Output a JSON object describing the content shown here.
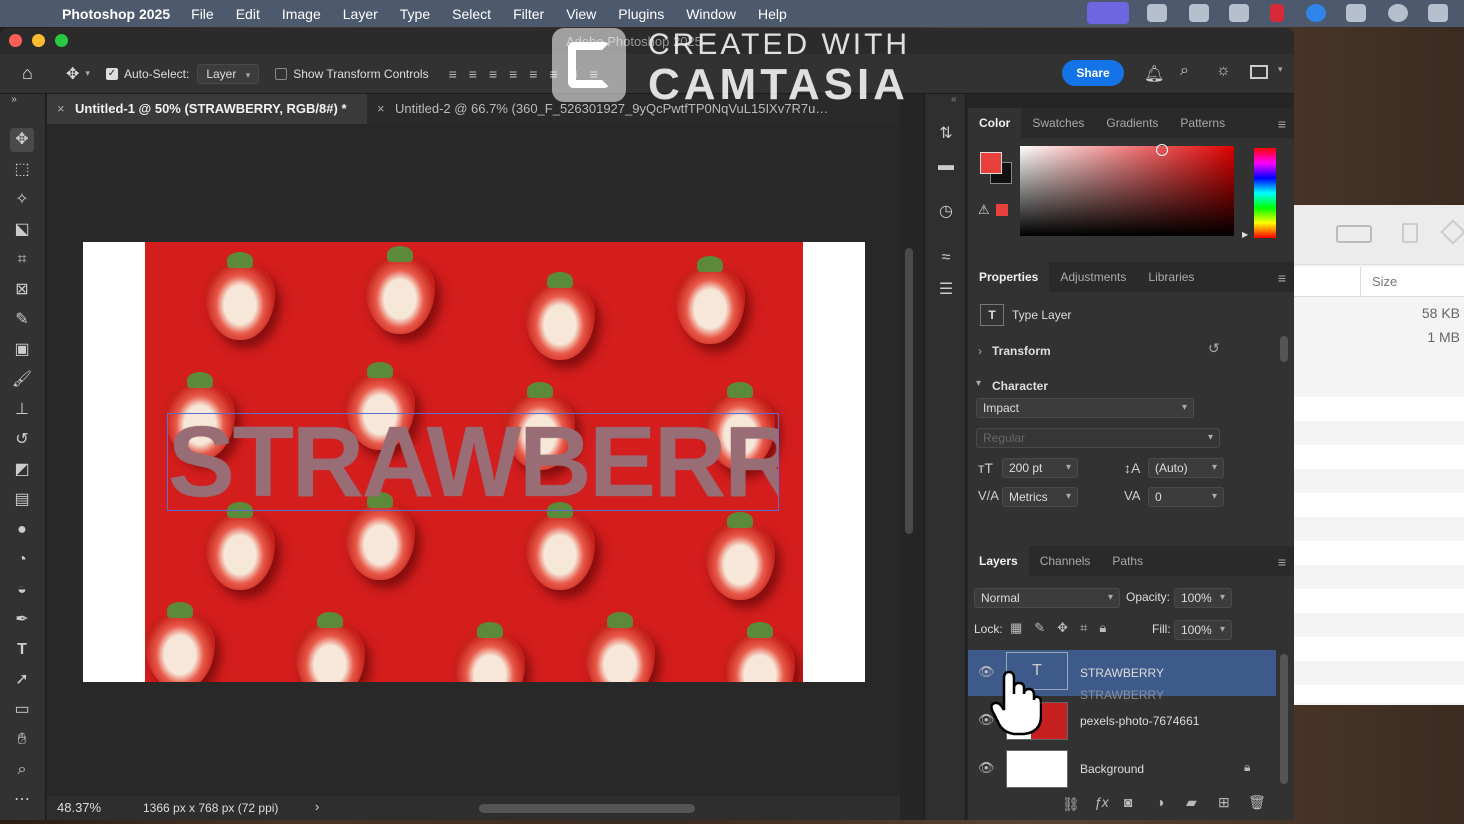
{
  "menubar": {
    "app_name": "Photoshop 2025",
    "items": [
      "File",
      "Edit",
      "Image",
      "Layer",
      "Type",
      "Select",
      "Filter",
      "View",
      "Plugins",
      "Window",
      "Help"
    ]
  },
  "window": {
    "title": "Adobe Photoshop 2025"
  },
  "watermark": {
    "line1": "CREATED WITH",
    "line2": "CAMTASIA"
  },
  "options_bar": {
    "auto_select_label": "Auto-Select:",
    "auto_select_value": "Layer",
    "transform_label": "Show Transform Controls",
    "share_label": "Share"
  },
  "tabs": [
    {
      "label": "Untitled-1 @ 50% (STRAWBERRY, RGB/8#) *",
      "close": "×"
    },
    {
      "label": "Untitled-2 @ 66.7% (360_F_526301927_9yQcPwtfTP0NqVuL15IXv7R7u…",
      "close": "×"
    }
  ],
  "canvas": {
    "text": "STRAWBERRY"
  },
  "status": {
    "zoom": "48.37%",
    "doc_info": "1366 px x 768 px (72 ppi)",
    "arrow": "›"
  },
  "color_panel": {
    "tabs": [
      "Color",
      "Swatches",
      "Gradients",
      "Patterns"
    ],
    "foreground": "#e8413c",
    "background": "#111111"
  },
  "properties_panel": {
    "tabs": [
      "Properties",
      "Adjustments",
      "Libraries"
    ],
    "layer_type": "Type Layer",
    "transform_label": "Transform",
    "character_label": "Character",
    "font_family": "Impact",
    "font_style": "Regular",
    "font_size": "200 pt",
    "leading": "(Auto)",
    "kerning": "Metrics",
    "tracking": "0"
  },
  "layers_panel": {
    "tabs": [
      "Layers",
      "Channels",
      "Paths"
    ],
    "blend_mode": "Normal",
    "opacity_label": "Opacity:",
    "opacity": "100%",
    "lock_label": "Lock:",
    "fill_label": "Fill:",
    "fill": "100%",
    "layers": [
      {
        "name": "STRAWBERRY",
        "ghost_name": "STRAWBERRY"
      },
      {
        "name": "pexels-photo-7674661"
      },
      {
        "name": "Background"
      }
    ]
  },
  "finder": {
    "column_header": "Size",
    "rows": [
      "58 KB",
      "1 MB"
    ]
  }
}
